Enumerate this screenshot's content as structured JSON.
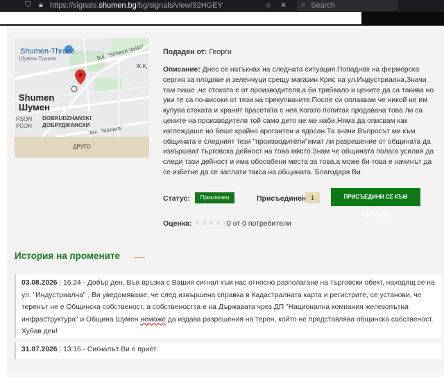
{
  "browser": {
    "url_prefix": "https://signals.",
    "url_domain": "shumen.bg",
    "url_suffix": "/bg/signals/view/92HGEY",
    "search_placeholder": "Search"
  },
  "map": {
    "label_place": "Shumen-Thrace",
    "label_small": "Шумен-Тракия",
    "label_city_en": "Shumen",
    "label_city_bg": "Шумен",
    "label_street1": "bul. \"Simeon Veliki\"",
    "label_district_en": "DOBRUDZHANSKI",
    "label_district_bg": "ДОБРУДЖАНСКИ",
    "label_street2": "bul. \"Madara\"",
    "label_gk": "Ж.К.",
    "label_rson": "RSON",
    "label_rson_bg": "РСОН",
    "other_button": "ДРУГО"
  },
  "signal": {
    "submitted_label": "Подаден от:",
    "submitted_by": "Георги",
    "description_label": "Описание:",
    "description": "Днес се натъкнах на следната ситуация.Попаднах на фермерска сергия за плодове и зеленчуци срещу магазин Крис на ул.Индустриална.Значи там пише ,че стоката е от производителя,а би трябвало и цените да са такива но уви те са по-високи от тези на прекупвачите.После си оплаквам че никой не им купува стоката и хранят прасетата с нея.Когато попитах продавача това ли са цените на производителя той само дето не ме наби.Няма да описвам как изглеждаше но беше крайно арогантен и ядосан.Та значи Въпросът ми към общината е следният тези \"производители\"имат ли разрешение от общината да извършват търговска дейност на това място.Знам че общината полага усилия да следи тази дейност и има обособени места за това,а може би това е начинът да се избегне да се заплати такса на общината. Благодаря Ви.",
    "status_label": "Статус:",
    "status_value": "Приключен",
    "joined_label": "Присъединени:",
    "joined_count": "1",
    "join_button": "ПРИСЪЕДИНИ СЕ КЪМ СИГНАЛА",
    "rating_label": "Оценка:",
    "rating_stars": "★★★★★",
    "rating_text": "0 от 0 потребители"
  },
  "history": {
    "title": "История на промените",
    "entries": [
      {
        "date": "03.08.2026",
        "time": "16:24",
        "text_before": "- Добър ден, Във връзка с Вашия сигнал към нас относно разполагане на търговски обект, находящ се на ул. \"Индустриална\" , Ви уведомяваме, че след извършена справка в Кадастралната карта и регистрите, се установи, че теренът не е Общинска собственост, а собствеността е на Държавата чрез ДП \"Национална компания железопътна инфраструктура\" и Община Шумен ",
        "text_misspelled": "неможе",
        "text_after": " да издава разрешения на терен, който не представлява общинска собственост. Хубав ден!"
      },
      {
        "date": "31.07.2026",
        "time": "13:16",
        "text": "- Сигналът Ви е приет"
      }
    ]
  }
}
